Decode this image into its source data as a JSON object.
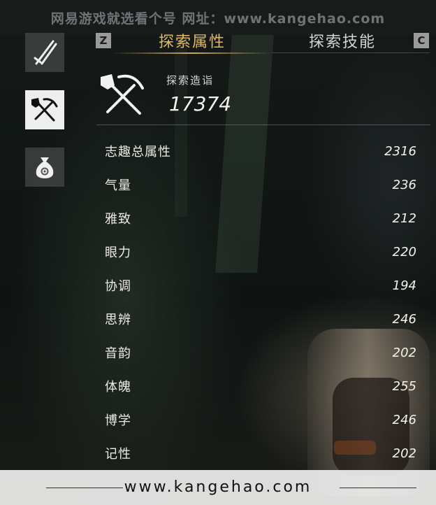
{
  "watermark": {
    "top_text": "网易游戏就选看个号  网址：www.kangehao.com",
    "bottom_url": "www.kangehao.com"
  },
  "sidebar": {
    "items": [
      {
        "icon": "sword-icon"
      },
      {
        "icon": "shovel-pickaxe-icon",
        "active": true
      },
      {
        "icon": "money-bag-icon"
      }
    ]
  },
  "tabs": {
    "left_key": "Z",
    "right_key": "C",
    "items": [
      {
        "label": "探索属性",
        "active": true
      },
      {
        "label": "探索技能",
        "active": false
      }
    ]
  },
  "score": {
    "label": "探索造诣",
    "value": "17374"
  },
  "attributes": [
    {
      "name": "志趣总属性",
      "value": "2316"
    },
    {
      "name": "气量",
      "value": "236"
    },
    {
      "name": "雅致",
      "value": "212"
    },
    {
      "name": "眼力",
      "value": "220"
    },
    {
      "name": "协调",
      "value": "194"
    },
    {
      "name": "思辨",
      "value": "246"
    },
    {
      "name": "音韵",
      "value": "202"
    },
    {
      "name": "体魄",
      "value": "255"
    },
    {
      "name": "博学",
      "value": "246"
    },
    {
      "name": "记性",
      "value": "202"
    }
  ],
  "colors": {
    "accent_gold": "#e0b764",
    "text_light": "#ecebe5",
    "active_sidebar_bg": "#eeeeee"
  }
}
